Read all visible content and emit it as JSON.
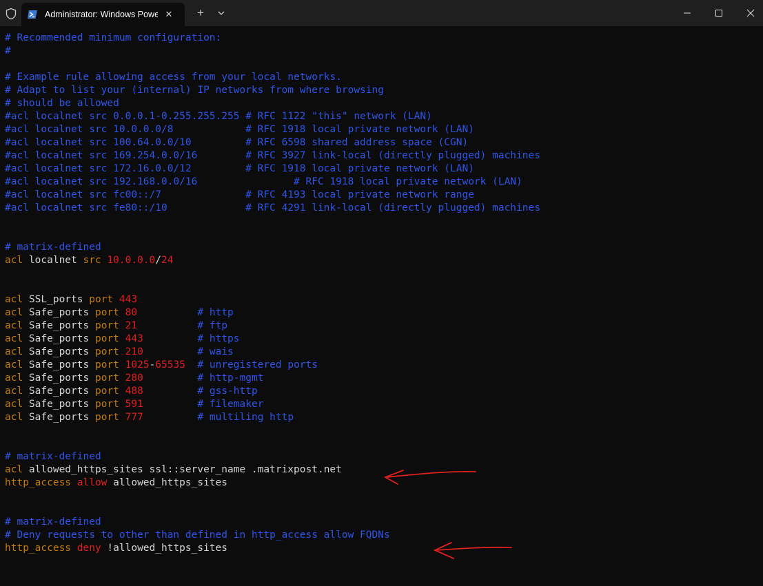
{
  "window": {
    "tab_title": "Administrator: Windows PowerShell",
    "new_tab_symbol": "+",
    "close_tab_symbol": "✕"
  },
  "colors": {
    "background": "#0c0c0c",
    "comment": "#2f55e8",
    "keyword": "#c27c10",
    "number": "#e02020",
    "text": "#d6d6d6",
    "annotation_arrow": "#e0201c"
  },
  "terminal": {
    "lines": [
      [
        {
          "t": "# Recommended minimum configuration:",
          "c": "c"
        }
      ],
      [
        {
          "t": "#",
          "c": "c"
        }
      ],
      [],
      [
        {
          "t": "# Example rule allowing access from your local networks.",
          "c": "c"
        }
      ],
      [
        {
          "t": "# Adapt to list your (internal) IP networks from where browsing",
          "c": "c"
        }
      ],
      [
        {
          "t": "# should be allowed",
          "c": "c"
        }
      ],
      [
        {
          "t": "#acl localnet src 0.0.0.1-0.255.255.255 # RFC 1122 \"this\" network (LAN)",
          "c": "c"
        }
      ],
      [
        {
          "t": "#acl localnet src 10.0.0.0/8            # RFC 1918 local private network (LAN)",
          "c": "c"
        }
      ],
      [
        {
          "t": "#acl localnet src 100.64.0.0/10         # RFC 6598 shared address space (CGN)",
          "c": "c"
        }
      ],
      [
        {
          "t": "#acl localnet src 169.254.0.0/16        # RFC 3927 link-local (directly plugged) machines",
          "c": "c"
        }
      ],
      [
        {
          "t": "#acl localnet src 172.16.0.0/12         # RFC 1918 local private network (LAN)",
          "c": "c"
        }
      ],
      [
        {
          "t": "#acl localnet src 192.168.0.0/16                # RFC 1918 local private network (LAN)",
          "c": "c"
        }
      ],
      [
        {
          "t": "#acl localnet src fc00::/7              # RFC 4193 local private network range",
          "c": "c"
        }
      ],
      [
        {
          "t": "#acl localnet src fe80::/10             # RFC 4291 link-local (directly plugged) machines",
          "c": "c"
        }
      ],
      [],
      [],
      [
        {
          "t": "# matrix-defined",
          "c": "c"
        }
      ],
      [
        {
          "t": "acl",
          "c": "kw"
        },
        {
          "t": " localnet ",
          "c": "tx"
        },
        {
          "t": "src",
          "c": "kw"
        },
        {
          "t": " ",
          "c": "tx"
        },
        {
          "t": "10.0.0.0",
          "c": "num"
        },
        {
          "t": "/",
          "c": "tx"
        },
        {
          "t": "24",
          "c": "num"
        }
      ],
      [],
      [],
      [
        {
          "t": "acl",
          "c": "kw"
        },
        {
          "t": " SSL_ports ",
          "c": "tx"
        },
        {
          "t": "port",
          "c": "kw"
        },
        {
          "t": " ",
          "c": "tx"
        },
        {
          "t": "443",
          "c": "num"
        }
      ],
      [
        {
          "t": "acl",
          "c": "kw"
        },
        {
          "t": " Safe_ports ",
          "c": "tx"
        },
        {
          "t": "port",
          "c": "kw"
        },
        {
          "t": " ",
          "c": "tx"
        },
        {
          "t": "80",
          "c": "num"
        },
        {
          "t": "          ",
          "c": "tx"
        },
        {
          "t": "# http",
          "c": "c"
        }
      ],
      [
        {
          "t": "acl",
          "c": "kw"
        },
        {
          "t": " Safe_ports ",
          "c": "tx"
        },
        {
          "t": "port",
          "c": "kw"
        },
        {
          "t": " ",
          "c": "tx"
        },
        {
          "t": "21",
          "c": "num"
        },
        {
          "t": "          ",
          "c": "tx"
        },
        {
          "t": "# ftp",
          "c": "c"
        }
      ],
      [
        {
          "t": "acl",
          "c": "kw"
        },
        {
          "t": " Safe_ports ",
          "c": "tx"
        },
        {
          "t": "port",
          "c": "kw"
        },
        {
          "t": " ",
          "c": "tx"
        },
        {
          "t": "443",
          "c": "num"
        },
        {
          "t": "         ",
          "c": "tx"
        },
        {
          "t": "# https",
          "c": "c"
        }
      ],
      [
        {
          "t": "acl",
          "c": "kw"
        },
        {
          "t": " Safe_ports ",
          "c": "tx"
        },
        {
          "t": "port",
          "c": "kw"
        },
        {
          "t": " ",
          "c": "tx"
        },
        {
          "t": "210",
          "c": "num"
        },
        {
          "t": "         ",
          "c": "tx"
        },
        {
          "t": "# wais",
          "c": "c"
        }
      ],
      [
        {
          "t": "acl",
          "c": "kw"
        },
        {
          "t": " Safe_ports ",
          "c": "tx"
        },
        {
          "t": "port",
          "c": "kw"
        },
        {
          "t": " ",
          "c": "tx"
        },
        {
          "t": "1025",
          "c": "num"
        },
        {
          "t": "-",
          "c": "tx"
        },
        {
          "t": "65535",
          "c": "num"
        },
        {
          "t": "  ",
          "c": "tx"
        },
        {
          "t": "# unregistered ports",
          "c": "c"
        }
      ],
      [
        {
          "t": "acl",
          "c": "kw"
        },
        {
          "t": " Safe_ports ",
          "c": "tx"
        },
        {
          "t": "port",
          "c": "kw"
        },
        {
          "t": " ",
          "c": "tx"
        },
        {
          "t": "280",
          "c": "num"
        },
        {
          "t": "         ",
          "c": "tx"
        },
        {
          "t": "# http-mgmt",
          "c": "c"
        }
      ],
      [
        {
          "t": "acl",
          "c": "kw"
        },
        {
          "t": " Safe_ports ",
          "c": "tx"
        },
        {
          "t": "port",
          "c": "kw"
        },
        {
          "t": " ",
          "c": "tx"
        },
        {
          "t": "488",
          "c": "num"
        },
        {
          "t": "         ",
          "c": "tx"
        },
        {
          "t": "# gss-http",
          "c": "c"
        }
      ],
      [
        {
          "t": "acl",
          "c": "kw"
        },
        {
          "t": " Safe_ports ",
          "c": "tx"
        },
        {
          "t": "port",
          "c": "kw"
        },
        {
          "t": " ",
          "c": "tx"
        },
        {
          "t": "591",
          "c": "num"
        },
        {
          "t": "         ",
          "c": "tx"
        },
        {
          "t": "# filemaker",
          "c": "c"
        }
      ],
      [
        {
          "t": "acl",
          "c": "kw"
        },
        {
          "t": " Safe_ports ",
          "c": "tx"
        },
        {
          "t": "port",
          "c": "kw"
        },
        {
          "t": " ",
          "c": "tx"
        },
        {
          "t": "777",
          "c": "num"
        },
        {
          "t": "         ",
          "c": "tx"
        },
        {
          "t": "# multiling http",
          "c": "c"
        }
      ],
      [],
      [],
      [
        {
          "t": "# matrix-defined",
          "c": "c"
        }
      ],
      [
        {
          "t": "acl",
          "c": "kw"
        },
        {
          "t": " allowed_https_sites ssl::server_name .matrixpost.net",
          "c": "tx"
        }
      ],
      [
        {
          "t": "http_access",
          "c": "kw"
        },
        {
          "t": " ",
          "c": "tx"
        },
        {
          "t": "allow",
          "c": "num"
        },
        {
          "t": " allowed_https_sites",
          "c": "tx"
        }
      ],
      [],
      [],
      [
        {
          "t": "# matrix-defined",
          "c": "c"
        }
      ],
      [
        {
          "t": "# Deny requests to other than defined in http_access allow FQDNs",
          "c": "c"
        }
      ],
      [
        {
          "t": "http_access",
          "c": "kw"
        },
        {
          "t": " ",
          "c": "tx"
        },
        {
          "t": "deny",
          "c": "num"
        },
        {
          "t": " !allowed_https_sites",
          "c": "tx"
        }
      ]
    ]
  }
}
